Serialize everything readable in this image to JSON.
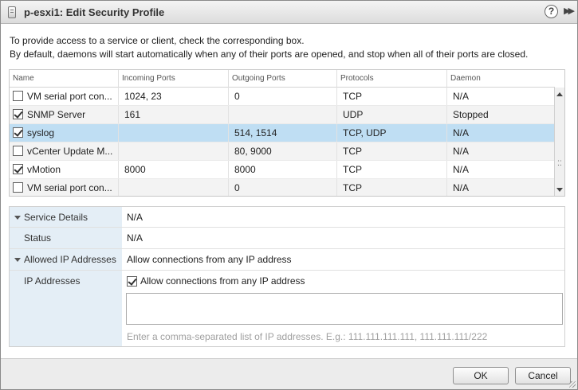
{
  "window": {
    "title": "p-esxi1: Edit Security Profile",
    "help_glyph": "?",
    "expand_glyph": "▶▶"
  },
  "intro": {
    "line1": "To provide access to a service or client, check the corresponding box.",
    "line2": "By default, daemons will start automatically when any of their ports are opened, and stop when all of their ports are closed."
  },
  "table": {
    "columns": [
      "Name",
      "Incoming Ports",
      "Outgoing Ports",
      "Protocols",
      "Daemon"
    ],
    "rows": [
      {
        "name": "VM serial port con...",
        "checked": false,
        "incoming": "1024, 23",
        "outgoing": "0",
        "protocols": "TCP",
        "daemon": "N/A",
        "selected": false
      },
      {
        "name": "SNMP Server",
        "checked": true,
        "incoming": "161",
        "outgoing": "",
        "protocols": "UDP",
        "daemon": "Stopped",
        "selected": false
      },
      {
        "name": "syslog",
        "checked": true,
        "incoming": "",
        "outgoing": "514, 1514",
        "protocols": "TCP, UDP",
        "daemon": "N/A",
        "selected": true
      },
      {
        "name": "vCenter Update M...",
        "checked": false,
        "incoming": "",
        "outgoing": "80, 9000",
        "protocols": "TCP",
        "daemon": "N/A",
        "selected": false
      },
      {
        "name": "vMotion",
        "checked": true,
        "incoming": "8000",
        "outgoing": "8000",
        "protocols": "TCP",
        "daemon": "N/A",
        "selected": false
      },
      {
        "name": "VM serial port con...",
        "checked": false,
        "incoming": "",
        "outgoing": "0",
        "protocols": "TCP",
        "daemon": "N/A",
        "selected": false
      }
    ]
  },
  "details": {
    "service_details_label": "Service Details",
    "service_details_value": "N/A",
    "status_label": "Status",
    "status_value": "N/A",
    "allowed_ip_label": "Allowed IP Addresses",
    "allowed_ip_value": "Allow connections from any IP address",
    "ip_addresses_label": "IP Addresses",
    "allow_any_checkbox_label": "Allow connections from any IP address",
    "allow_any_checked": true,
    "ip_list_value": "",
    "ip_hint": "Enter a comma-separated list of IP addresses. E.g.: 111.111.111.111, 111.111.111/222"
  },
  "buttons": {
    "ok": "OK",
    "cancel": "Cancel"
  }
}
